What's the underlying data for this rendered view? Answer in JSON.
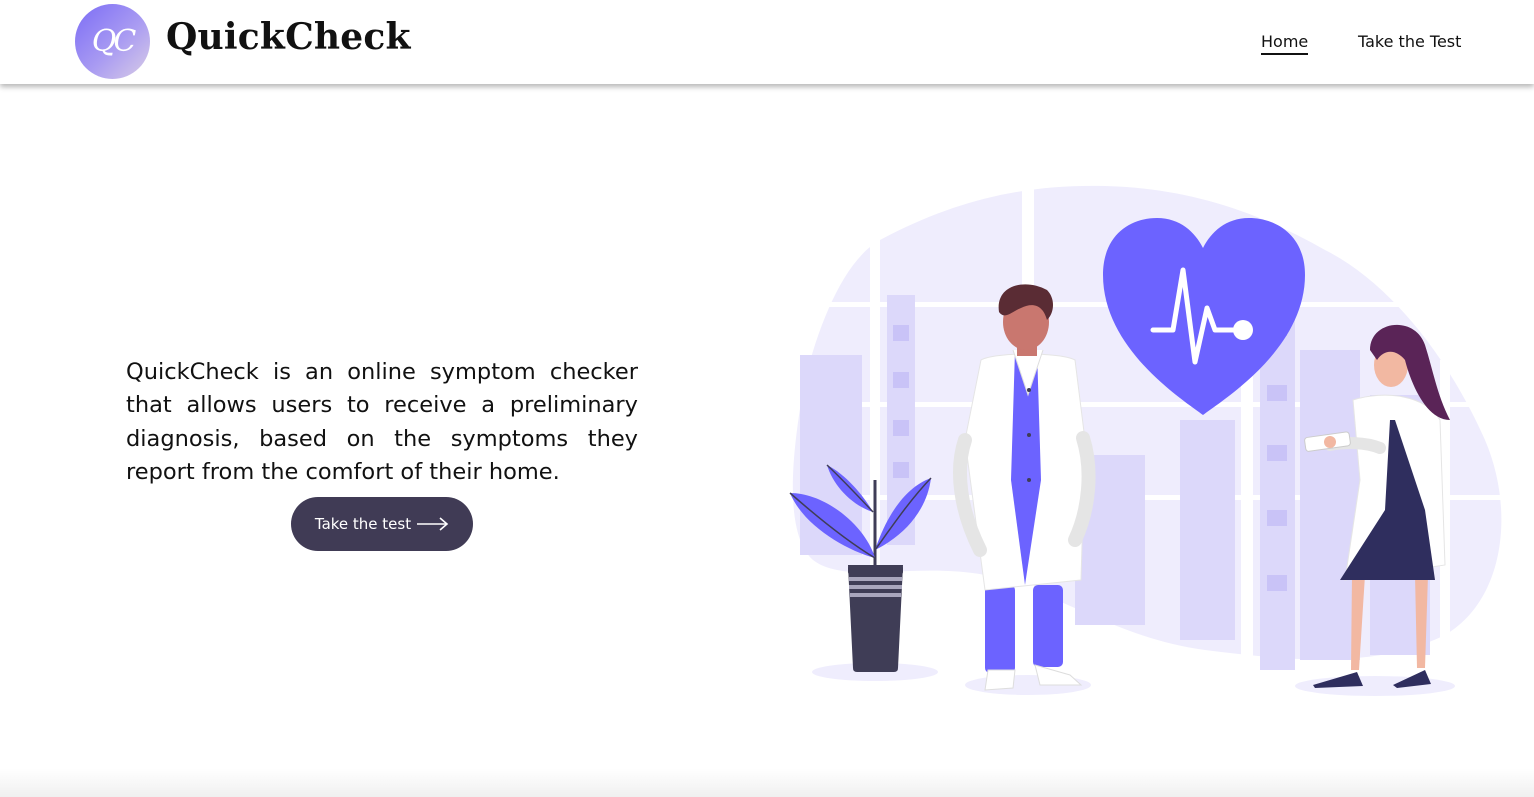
{
  "header": {
    "logo_text": "QC",
    "brand": "QuickCheck",
    "nav": [
      {
        "label": "Home",
        "active": true
      },
      {
        "label": "Take the Test",
        "active": false
      }
    ]
  },
  "hero": {
    "description": "QuickCheck is an online symptom checker that allows users to receive a preliminary diagnosis, based on the symptoms they report from the comfort of their home.",
    "cta_label": "Take the test",
    "cta_icon": "arrow-right-icon"
  },
  "illustration": {
    "name": "doctors-heart-illustration",
    "colors": {
      "accent": "#6c63ff",
      "blob": "#efedfd",
      "blob_dark": "#dcd8fa",
      "dark": "#3f3d56",
      "skin": "#c9776f"
    }
  },
  "colors": {
    "cta_bg": "#403b55",
    "logo_gradient_start": "#7b6cf6",
    "logo_gradient_end": "#d9cde6"
  }
}
